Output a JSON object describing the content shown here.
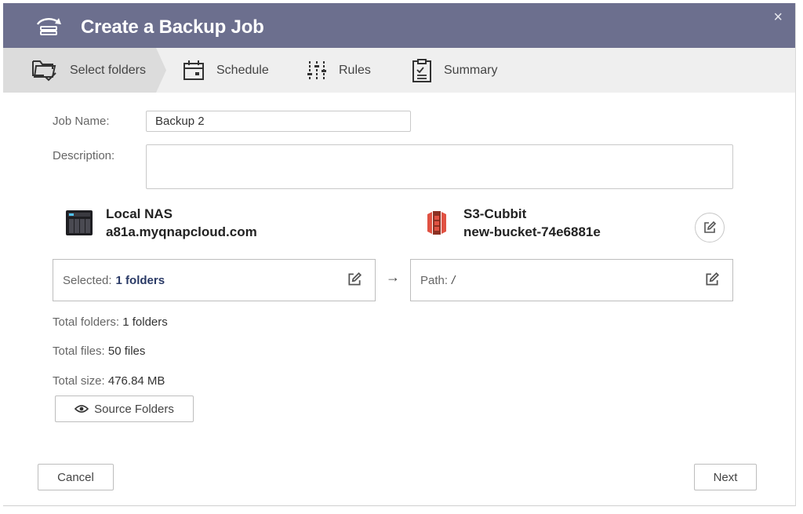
{
  "dialog": {
    "title": "Create a Backup Job",
    "close_label": "×"
  },
  "steps": [
    {
      "label": "Select folders",
      "icon": "folder-check-icon",
      "active": true
    },
    {
      "label": "Schedule",
      "icon": "calendar-icon",
      "active": false
    },
    {
      "label": "Rules",
      "icon": "sliders-icon",
      "active": false
    },
    {
      "label": "Summary",
      "icon": "clipboard-icon",
      "active": false
    }
  ],
  "form": {
    "job_name_label": "Job Name:",
    "job_name_value": "Backup 2",
    "description_label": "Description:",
    "description_value": ""
  },
  "source": {
    "name": "Local NAS",
    "host": "a81a.myqnapcloud.com",
    "selected_label": "Selected:",
    "selected_value": "1 folders",
    "icon": "nas-device-icon"
  },
  "destination": {
    "name": "S3-Cubbit",
    "bucket": "new-bucket-74e6881e",
    "path_label": "Path:",
    "path_value": "/",
    "icon": "s3-bucket-icon"
  },
  "arrow": "→",
  "stats": {
    "total_folders_label": "Total folders:",
    "total_folders_value": "1 folders",
    "total_files_label": "Total files:",
    "total_files_value": "50 files",
    "total_size_label": "Total size:",
    "total_size_value": "476.84 MB"
  },
  "buttons": {
    "source_folders": "Source Folders",
    "cancel": "Cancel",
    "next": "Next"
  },
  "colors": {
    "titlebar": "#6c6f8e",
    "stepbar": "#efefef",
    "active_step": "#dcdcdc",
    "link": "#2a3a66"
  }
}
